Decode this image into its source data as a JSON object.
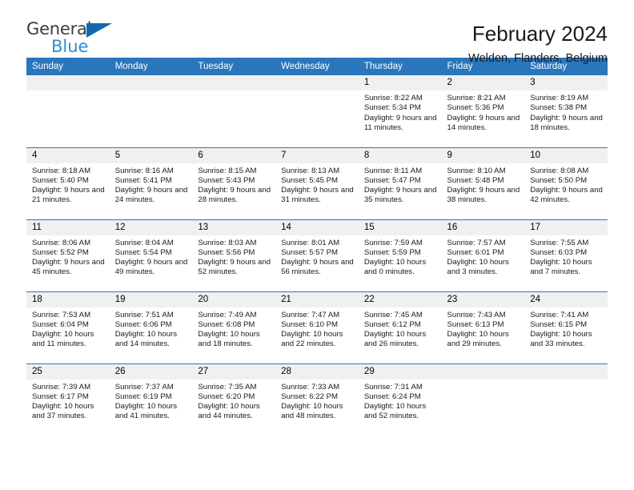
{
  "logo": {
    "word1": "General",
    "word2": "Blue",
    "triangle_color": "#1567b2",
    "word2_color": "#2a8fd4"
  },
  "header": {
    "title": "February 2024",
    "subtitle": "Welden, Flanders, Belgium"
  },
  "theme": {
    "header_bg": "#2a76bc",
    "daynum_bg": "#f0f0f0",
    "separator": "#2a76bc"
  },
  "weekday_headers": [
    "Sunday",
    "Monday",
    "Tuesday",
    "Wednesday",
    "Thursday",
    "Friday",
    "Saturday"
  ],
  "weeks": [
    [
      {
        "day": "",
        "lines": []
      },
      {
        "day": "",
        "lines": []
      },
      {
        "day": "",
        "lines": []
      },
      {
        "day": "",
        "lines": []
      },
      {
        "day": "1",
        "lines": [
          "Sunrise: 8:22 AM",
          "Sunset: 5:34 PM",
          "Daylight: 9 hours and 11 minutes."
        ]
      },
      {
        "day": "2",
        "lines": [
          "Sunrise: 8:21 AM",
          "Sunset: 5:36 PM",
          "Daylight: 9 hours and 14 minutes."
        ]
      },
      {
        "day": "3",
        "lines": [
          "Sunrise: 8:19 AM",
          "Sunset: 5:38 PM",
          "Daylight: 9 hours and 18 minutes."
        ]
      }
    ],
    [
      {
        "day": "4",
        "lines": [
          "Sunrise: 8:18 AM",
          "Sunset: 5:40 PM",
          "Daylight: 9 hours and 21 minutes."
        ]
      },
      {
        "day": "5",
        "lines": [
          "Sunrise: 8:16 AM",
          "Sunset: 5:41 PM",
          "Daylight: 9 hours and 24 minutes."
        ]
      },
      {
        "day": "6",
        "lines": [
          "Sunrise: 8:15 AM",
          "Sunset: 5:43 PM",
          "Daylight: 9 hours and 28 minutes."
        ]
      },
      {
        "day": "7",
        "lines": [
          "Sunrise: 8:13 AM",
          "Sunset: 5:45 PM",
          "Daylight: 9 hours and 31 minutes."
        ]
      },
      {
        "day": "8",
        "lines": [
          "Sunrise: 8:11 AM",
          "Sunset: 5:47 PM",
          "Daylight: 9 hours and 35 minutes."
        ]
      },
      {
        "day": "9",
        "lines": [
          "Sunrise: 8:10 AM",
          "Sunset: 5:48 PM",
          "Daylight: 9 hours and 38 minutes."
        ]
      },
      {
        "day": "10",
        "lines": [
          "Sunrise: 8:08 AM",
          "Sunset: 5:50 PM",
          "Daylight: 9 hours and 42 minutes."
        ]
      }
    ],
    [
      {
        "day": "11",
        "lines": [
          "Sunrise: 8:06 AM",
          "Sunset: 5:52 PM",
          "Daylight: 9 hours and 45 minutes."
        ]
      },
      {
        "day": "12",
        "lines": [
          "Sunrise: 8:04 AM",
          "Sunset: 5:54 PM",
          "Daylight: 9 hours and 49 minutes."
        ]
      },
      {
        "day": "13",
        "lines": [
          "Sunrise: 8:03 AM",
          "Sunset: 5:56 PM",
          "Daylight: 9 hours and 52 minutes."
        ]
      },
      {
        "day": "14",
        "lines": [
          "Sunrise: 8:01 AM",
          "Sunset: 5:57 PM",
          "Daylight: 9 hours and 56 minutes."
        ]
      },
      {
        "day": "15",
        "lines": [
          "Sunrise: 7:59 AM",
          "Sunset: 5:59 PM",
          "Daylight: 10 hours and 0 minutes."
        ]
      },
      {
        "day": "16",
        "lines": [
          "Sunrise: 7:57 AM",
          "Sunset: 6:01 PM",
          "Daylight: 10 hours and 3 minutes."
        ]
      },
      {
        "day": "17",
        "lines": [
          "Sunrise: 7:55 AM",
          "Sunset: 6:03 PM",
          "Daylight: 10 hours and 7 minutes."
        ]
      }
    ],
    [
      {
        "day": "18",
        "lines": [
          "Sunrise: 7:53 AM",
          "Sunset: 6:04 PM",
          "Daylight: 10 hours and 11 minutes."
        ]
      },
      {
        "day": "19",
        "lines": [
          "Sunrise: 7:51 AM",
          "Sunset: 6:06 PM",
          "Daylight: 10 hours and 14 minutes."
        ]
      },
      {
        "day": "20",
        "lines": [
          "Sunrise: 7:49 AM",
          "Sunset: 6:08 PM",
          "Daylight: 10 hours and 18 minutes."
        ]
      },
      {
        "day": "21",
        "lines": [
          "Sunrise: 7:47 AM",
          "Sunset: 6:10 PM",
          "Daylight: 10 hours and 22 minutes."
        ]
      },
      {
        "day": "22",
        "lines": [
          "Sunrise: 7:45 AM",
          "Sunset: 6:12 PM",
          "Daylight: 10 hours and 26 minutes."
        ]
      },
      {
        "day": "23",
        "lines": [
          "Sunrise: 7:43 AM",
          "Sunset: 6:13 PM",
          "Daylight: 10 hours and 29 minutes."
        ]
      },
      {
        "day": "24",
        "lines": [
          "Sunrise: 7:41 AM",
          "Sunset: 6:15 PM",
          "Daylight: 10 hours and 33 minutes."
        ]
      }
    ],
    [
      {
        "day": "25",
        "lines": [
          "Sunrise: 7:39 AM",
          "Sunset: 6:17 PM",
          "Daylight: 10 hours and 37 minutes."
        ]
      },
      {
        "day": "26",
        "lines": [
          "Sunrise: 7:37 AM",
          "Sunset: 6:19 PM",
          "Daylight: 10 hours and 41 minutes."
        ]
      },
      {
        "day": "27",
        "lines": [
          "Sunrise: 7:35 AM",
          "Sunset: 6:20 PM",
          "Daylight: 10 hours and 44 minutes."
        ]
      },
      {
        "day": "28",
        "lines": [
          "Sunrise: 7:33 AM",
          "Sunset: 6:22 PM",
          "Daylight: 10 hours and 48 minutes."
        ]
      },
      {
        "day": "29",
        "lines": [
          "Sunrise: 7:31 AM",
          "Sunset: 6:24 PM",
          "Daylight: 10 hours and 52 minutes."
        ]
      },
      {
        "day": "",
        "lines": []
      },
      {
        "day": "",
        "lines": []
      }
    ]
  ]
}
